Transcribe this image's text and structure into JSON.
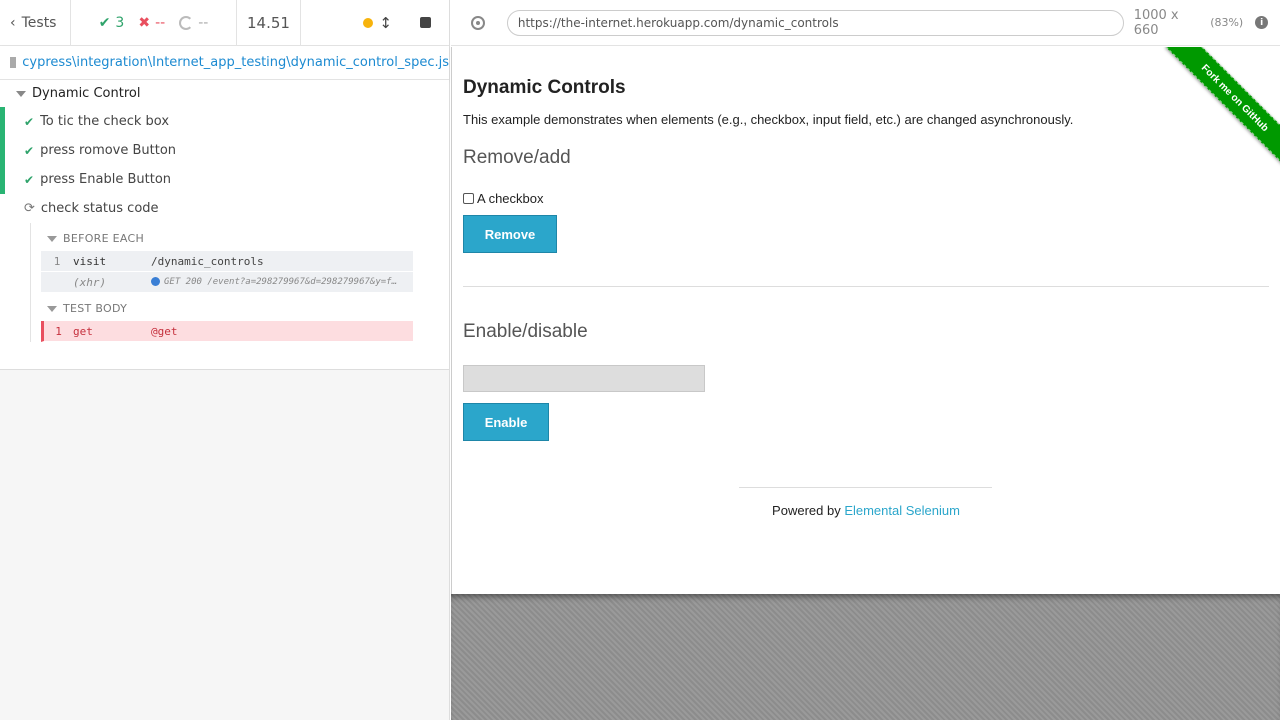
{
  "reporter": {
    "back_label": "Tests",
    "passed": "3",
    "failed": "--",
    "pending": "--",
    "duration": "14.51",
    "spec_path": "cypress\\integration\\Internet_app_testing\\dynamic_control_spec.js",
    "suite_title": "Dynamic Control",
    "tests": [
      {
        "title": "To tic the check box",
        "state": "passed"
      },
      {
        "title": "press romove Button",
        "state": "passed"
      },
      {
        "title": "press Enable Button",
        "state": "passed"
      },
      {
        "title": "check status code",
        "state": "running"
      }
    ],
    "before_each_label": "BEFORE EACH",
    "before_each_cmds": [
      {
        "num": "1",
        "name": "visit",
        "msg": "/dynamic_controls"
      },
      {
        "num": "",
        "name": "(xhr)",
        "msg": "GET 200 /event?a=298279967&d=298279967&y=f…"
      }
    ],
    "test_body_label": "TEST BODY",
    "test_body_cmds": [
      {
        "num": "1",
        "name": "get",
        "msg": "@get"
      }
    ]
  },
  "aut": {
    "url": "https://the-internet.herokuapp.com/dynamic_controls",
    "viewport": "1000 x 660",
    "scale": "(83%)",
    "page": {
      "title": "Dynamic Controls",
      "description": "This example demonstrates when elements (e.g., checkbox, input field, etc.) are changed asynchronously.",
      "remove_add_heading": "Remove/add",
      "checkbox_label": "A checkbox",
      "remove_button": "Remove",
      "enable_disable_heading": "Enable/disable",
      "enable_button": "Enable",
      "footer_prefix": "Powered by ",
      "footer_link": "Elemental Selenium",
      "ribbon": "Fork me on GitHub"
    }
  },
  "colors": {
    "pass": "#2fa36b",
    "fail": "#e94f5f",
    "link": "#1c8ad1",
    "button": "#2ba6cb",
    "ribbon": "#009900"
  }
}
